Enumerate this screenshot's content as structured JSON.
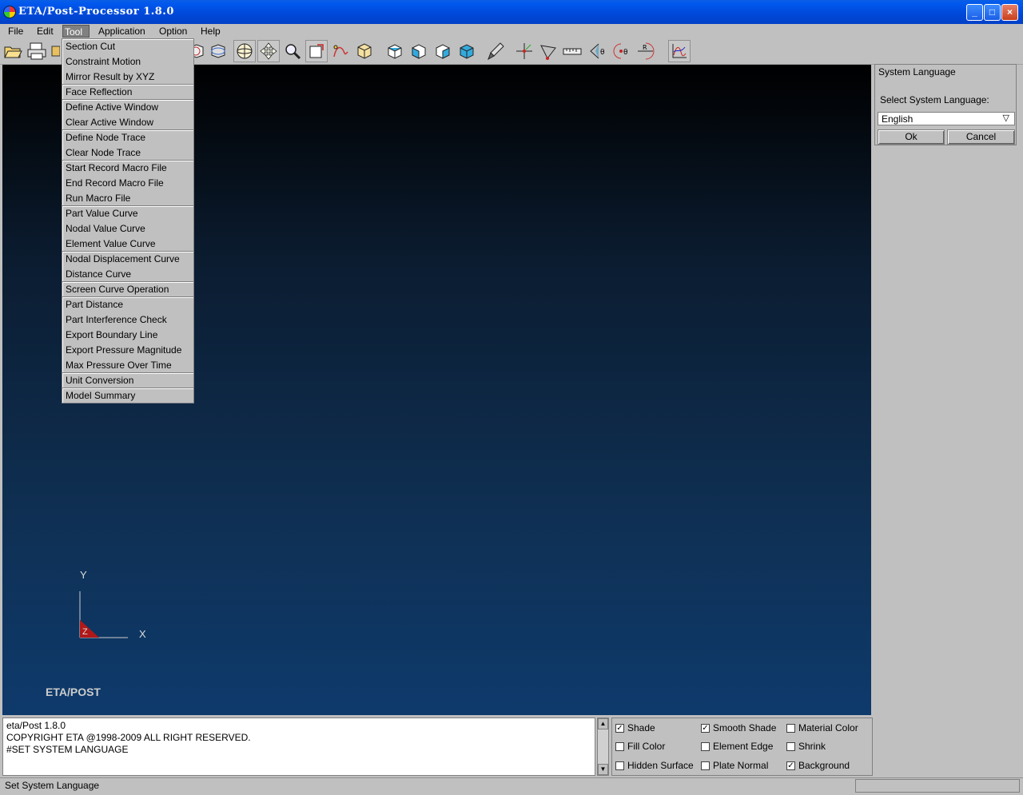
{
  "window": {
    "title": "ETA/Post-Processor 1.8.0",
    "minimize_glyph": "_",
    "maximize_glyph": "□",
    "close_glyph": "×"
  },
  "menubar": {
    "items": [
      {
        "label": "File"
      },
      {
        "label": "Edit"
      },
      {
        "label": "Tool"
      },
      {
        "label": "Application"
      },
      {
        "label": "Option"
      },
      {
        "label": "Help"
      }
    ]
  },
  "tool_menu": {
    "items": [
      "Section Cut",
      "Constraint Motion",
      "Mirror Result by XYZ",
      "Face Reflection",
      "Define Active Window",
      "Clear Active Window",
      "Define Node Trace",
      "Clear Node Trace",
      "Start Record Macro File",
      "End Record Macro File",
      "Run Macro File",
      "Part Value Curve",
      "Nodal Value Curve",
      "Element Value Curve",
      "Nodal Displacement Curve",
      "Distance Curve",
      "Screen Curve Operation",
      "Part Distance",
      "Part Interference Check",
      "Export Boundary Line",
      "Export Pressure Magnitude",
      "Max Pressure Over Time",
      "Unit Conversion",
      "Model Summary"
    ]
  },
  "viewport": {
    "axis_y": "Y",
    "axis_x": "X",
    "axis_z": "Z",
    "logo": "ETA/POST"
  },
  "system_language": {
    "title": "System Language",
    "label": "Select System Language:",
    "selected": "English",
    "ok": "Ok",
    "cancel": "Cancel"
  },
  "console": {
    "lines": [
      "eta/Post 1.8.0",
      "COPYRIGHT ETA @1998-2009 ALL RIGHT RESERVED.",
      "#SET SYSTEM LANGUAGE"
    ]
  },
  "options": {
    "shade": {
      "label": "Shade",
      "checked": true
    },
    "smooth_shade": {
      "label": "Smooth Shade",
      "checked": true
    },
    "material_color": {
      "label": "Material Color",
      "checked": false
    },
    "fill_color": {
      "label": "Fill Color",
      "checked": false
    },
    "element_edge": {
      "label": "Element Edge",
      "checked": false
    },
    "shrink": {
      "label": "Shrink",
      "checked": false
    },
    "hidden_surface": {
      "label": "Hidden Surface",
      "checked": false
    },
    "plate_normal": {
      "label": "Plate Normal",
      "checked": false
    },
    "background": {
      "label": "Background",
      "checked": true
    }
  },
  "statusbar": {
    "text": "Set System Language"
  },
  "colors": {
    "titlebar": "#0054e3",
    "axis_triangle": "#b01818"
  }
}
